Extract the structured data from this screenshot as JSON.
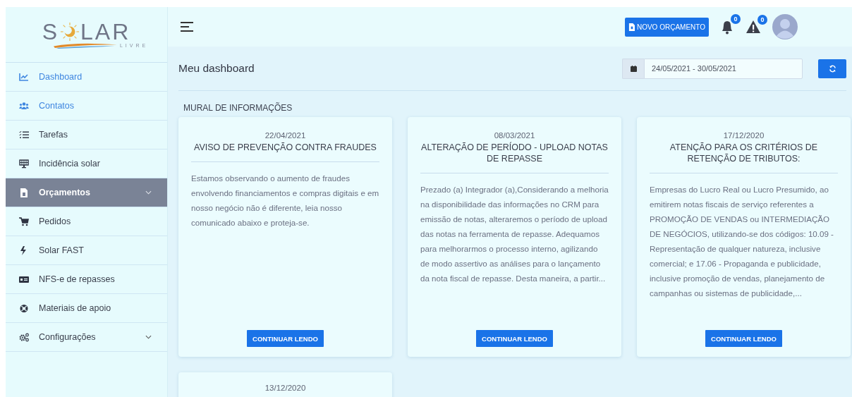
{
  "logo": {
    "left": "S",
    "right": "LAR",
    "tagline": "LIVRE"
  },
  "sidebar": {
    "items": [
      {
        "label": "Dashboard",
        "highlighted": true,
        "selected": false
      },
      {
        "label": "Contatos",
        "highlighted": true,
        "selected": false
      },
      {
        "label": "Tarefas",
        "highlighted": false,
        "selected": false
      },
      {
        "label": "Incidência solar",
        "highlighted": false,
        "selected": false
      },
      {
        "label": "Orçamentos",
        "highlighted": false,
        "selected": true,
        "expandable": true
      },
      {
        "label": "Pedidos",
        "highlighted": false,
        "selected": false
      },
      {
        "label": "Solar FAST",
        "highlighted": false,
        "selected": false
      },
      {
        "label": "NFS-e de repasses",
        "highlighted": false,
        "selected": false
      },
      {
        "label": "Materiais de apoio",
        "highlighted": false,
        "selected": false
      },
      {
        "label": "Configurações",
        "highlighted": false,
        "selected": false,
        "expandable": true
      }
    ]
  },
  "topbar": {
    "new_quote_button": "NOVO ORÇAMENTO",
    "notifications_count": "0",
    "alerts_count": "0"
  },
  "page_title": "Meu dashboard",
  "date_range": {
    "value": "24/05/2021 - 30/05/2021"
  },
  "section_title": "MURAL DE INFORMAÇÕES",
  "cards": [
    {
      "date": "22/04/2021",
      "title": "AVISO DE PREVENÇÃO CONTRA FRAUDES",
      "body": "Estamos observando o aumento de fraudes envolvendo financiamentos e compras digitais e em nosso negócio não é diferente, leia nosso comunicado abaixo e proteja-se.",
      "button": "CONTINUAR LENDO"
    },
    {
      "date": "08/03/2021",
      "title": "ALTERAÇÃO DE PERÍODO - UPLOAD NOTAS DE REPASSE",
      "body": "Prezado (a) Integrador (a),Considerando a melhoria na disponibilidade das informações no CRM para emissão de notas, alteraremos o período de upload das notas na ferramenta de repasse. Adequamos para melhorarmos o processo interno, agilizando de modo assertivo as análises para o lançamento da nota fiscal de repasse. Desta maneira, a partir...",
      "button": "CONTINUAR LENDO"
    },
    {
      "date": "17/12/2020",
      "title": "ATENÇÃO PARA OS CRITÉRIOS DE RETENÇÃO DE TRIBUTOS:",
      "body": "Empresas do Lucro Real ou Lucro Presumido, ao emitirem notas fiscais de serviço referentes a PROMOÇÃO DE VENDAS ou INTERMEDIAÇÃO DE NEGÓCIOS, utilizando-se dos códigos: 10.09 - Representação de qualquer natureza, inclusive comercial; e 17.06 - Propaganda e publicidade, inclusive promoção de vendas, planejamento de campanhas ou sistemas de publicidade,...",
      "button": "CONTINUAR LENDO"
    },
    {
      "date": "13/12/2020"
    }
  ]
}
